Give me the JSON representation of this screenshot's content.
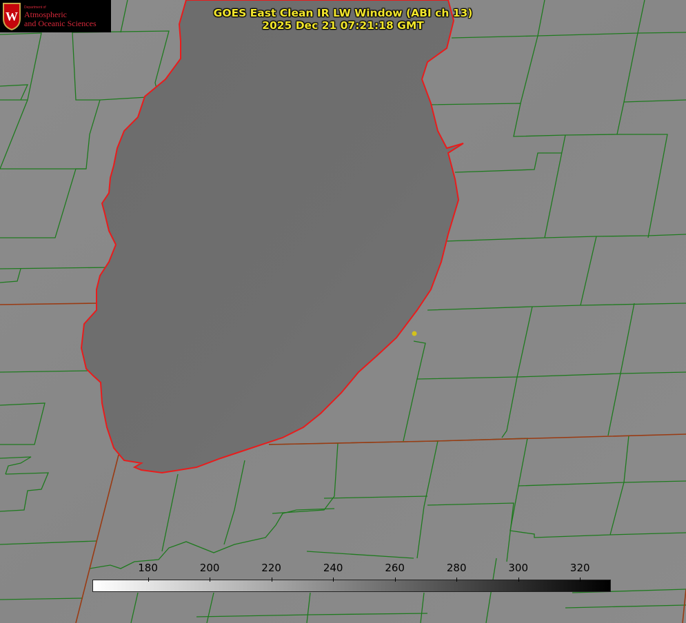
{
  "header": {
    "title_line1": "GOES East Clean IR LW Window (ABI ch 13)",
    "title_line2": "2025 Dec 21 07:21:18 GMT"
  },
  "logo": {
    "dept_text": "Department of",
    "line1": "Atmospheric",
    "line2": "and Oceanic Sciences",
    "crest_letter": "W",
    "icon": "uw-crest-icon"
  },
  "colors": {
    "title": "#f2e62c",
    "lake_outline": "#e81c1c",
    "county_lines": "#1e7a1e",
    "state_lines": "#9a3a12",
    "land": "#8a8a8a",
    "lake": "#6d6d6d",
    "marker": "#d4c21c"
  },
  "colorbar": {
    "units": "",
    "ticks": [
      {
        "label": "180",
        "value": 180
      },
      {
        "label": "200",
        "value": 200
      },
      {
        "label": "220",
        "value": 220
      },
      {
        "label": "240",
        "value": 240
      },
      {
        "label": "260",
        "value": 260
      },
      {
        "label": "280",
        "value": 280
      },
      {
        "label": "300",
        "value": 300
      },
      {
        "label": "320",
        "value": 320
      }
    ],
    "range": [
      162,
      330
    ],
    "gradient_from": "#ffffff",
    "gradient_to": "#000000"
  }
}
